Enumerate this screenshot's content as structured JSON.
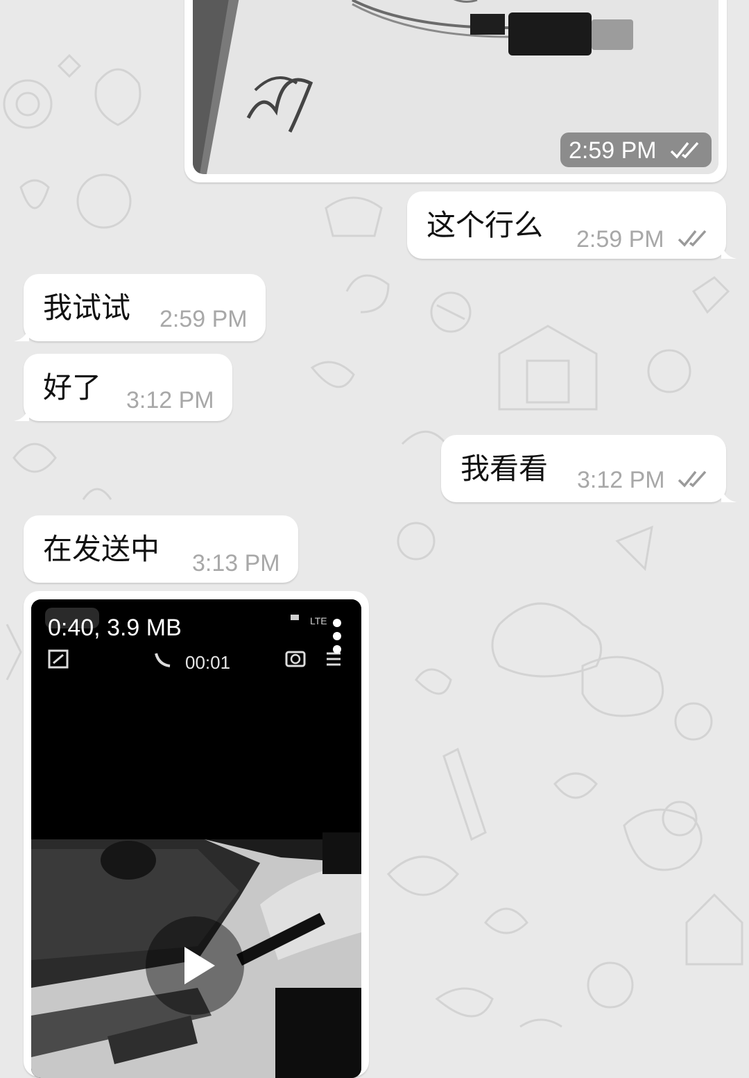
{
  "messages": [
    {
      "id": "m1",
      "side": "out",
      "type": "photo",
      "time": "2:59 PM",
      "status": "read"
    },
    {
      "id": "m2",
      "side": "out",
      "type": "text",
      "text": "这个行么",
      "time": "2:59 PM",
      "status": "read"
    },
    {
      "id": "m3",
      "side": "in",
      "type": "text",
      "text": "我试试",
      "time": "2:59 PM"
    },
    {
      "id": "m4",
      "side": "in",
      "type": "text",
      "text": "好了",
      "time": "3:12 PM"
    },
    {
      "id": "m5",
      "side": "out",
      "type": "text",
      "text": "我看看",
      "time": "3:12 PM",
      "status": "read"
    },
    {
      "id": "m6",
      "side": "in",
      "type": "text",
      "text": "在发送中",
      "time": "3:13 PM"
    },
    {
      "id": "m7",
      "side": "in",
      "type": "video",
      "meta": "0:40, 3.9 MB",
      "recording_timer": "00:01"
    }
  ],
  "icons": {
    "read_status": "double-check-icon",
    "video_play": "play-icon",
    "video_menu": "more-vertical-icon"
  },
  "colors": {
    "chat_background": "#e9e9e9",
    "bubble": "#ffffff",
    "time_text": "#a8a8a8"
  }
}
